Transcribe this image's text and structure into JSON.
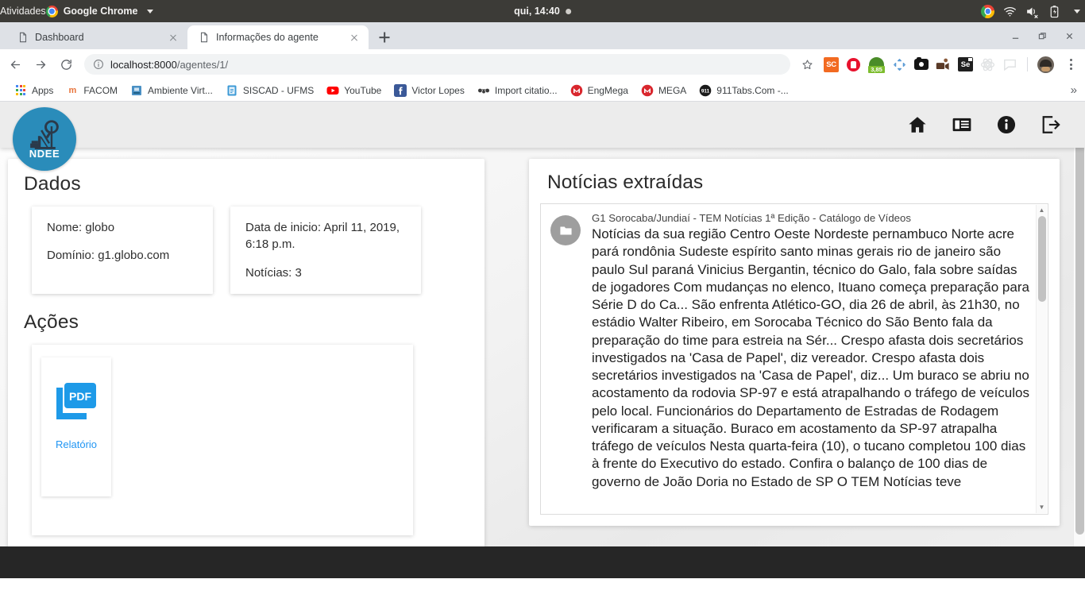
{
  "desktop": {
    "activities": "Atividades",
    "app_menu": "Google Chrome",
    "clock": "qui, 14:40",
    "tray": [
      "chrome-icon",
      "wifi-icon",
      "volume-muted-icon",
      "battery-charging-icon",
      "system-menu-caret"
    ]
  },
  "browser": {
    "tabs": [
      {
        "title": "Dashboard",
        "active": false
      },
      {
        "title": "Informações do agente",
        "active": true
      }
    ],
    "new_tab_label": "+",
    "window_controls": [
      "minimize",
      "restore",
      "close"
    ],
    "nav": {
      "back": "back-icon",
      "forward": "forward-icon",
      "reload": "reload-icon"
    },
    "omnibox": {
      "host": "localhost:8000",
      "path": "/agentes/1/",
      "full": "localhost:8000/agentes/1/"
    },
    "extensions": [
      "SC",
      "opera-icon",
      "3,85",
      "move-icon",
      "camera-icon",
      "video-icon",
      "Se",
      "atom-icon",
      "chat-icon",
      "ninja-avatar"
    ],
    "menu": "chrome-menu",
    "bookmarks": [
      {
        "label": "Apps",
        "icon": "apps-grid-icon"
      },
      {
        "label": "FACOM",
        "icon": "facom-icon"
      },
      {
        "label": "Ambiente Virt...",
        "icon": "moodle-icon"
      },
      {
        "label": "SISCAD - UFMS",
        "icon": "siscad-icon"
      },
      {
        "label": "YouTube",
        "icon": "youtube-icon"
      },
      {
        "label": "Victor Lopes",
        "icon": "facebook-icon"
      },
      {
        "label": "Import citatio...",
        "icon": "mendeley-icon"
      },
      {
        "label": "EngMega",
        "icon": "mega-icon"
      },
      {
        "label": "MEGA",
        "icon": "mega-icon"
      },
      {
        "label": "911Tabs.Com -...",
        "icon": "911tabs-icon"
      }
    ],
    "bookmarks_overflow": "»"
  },
  "app": {
    "logo": {
      "text": "NDEE",
      "color": "#2a8cba"
    },
    "nav_icons": [
      "home-icon",
      "articles-icon",
      "info-icon",
      "logout-icon"
    ]
  },
  "dados": {
    "title": "Dados",
    "card1": {
      "nome": "Nome: globo",
      "dominio": "Domínio: g1.globo.com"
    },
    "card2": {
      "data_inicio": "Data de inicio: April 11, 2019, 6:18 p.m.",
      "noticias": "Notícias: 3"
    }
  },
  "acoes": {
    "title": "Ações",
    "tile": {
      "icon": "pdf-icon",
      "label": "Relatório",
      "label_color": "#2196f3"
    }
  },
  "noticias": {
    "title": "Notícias extraídas",
    "item": {
      "avatar_icon": "folder-icon",
      "headline": "G1 Sorocaba/Jundiaí - TEM Notícias 1ª Edição - Catálogo de Vídeos",
      "body": "Notícias da sua região Centro Oeste Nordeste pernambuco Norte acre pará rondônia Sudeste espírito santo minas gerais rio de janeiro são paulo Sul paraná Vinicius Bergantin, técnico do Galo, fala sobre saídas de jogadores Com mudanças no elenco, Ituano começa preparação para Série D do Ca... São enfrenta Atlético-GO, dia 26 de abril, às 21h30, no estádio Walter Ribeiro, em Sorocaba Técnico do São Bento fala da preparação do time para estreia na Sér... Crespo afasta dois secretários investigados na 'Casa de Papel', diz vereador. Crespo afasta dois secretários investigados na 'Casa de Papel', diz... Um buraco se abriu no acostamento da rodovia SP-97 e está atrapalhando o tráfego de veículos pelo local. Funcionários do Departamento de Estradas de Rodagem verificaram a situação. Buraco em acostamento da SP-97 atrapalha tráfego de veículos Nesta quarta-feira (10), o tucano completou 100 dias à frente do Executivo do estado. Confira o balanço de 100 dias de governo de João Doria no Estado de SP O TEM Notícias teve"
    }
  }
}
